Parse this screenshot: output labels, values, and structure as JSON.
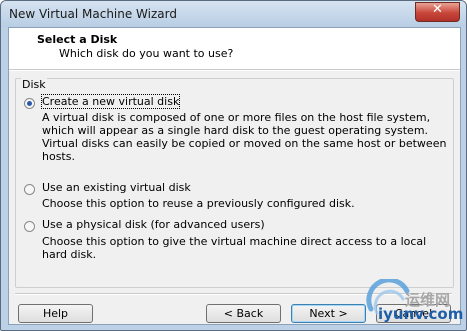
{
  "window": {
    "title": "New Virtual Machine Wizard"
  },
  "header": {
    "title": "Select a Disk",
    "subtitle": "Which disk do you want to use?"
  },
  "disk_group": {
    "legend": "Disk",
    "options": [
      {
        "label": "Create a new virtual disk",
        "selected": true,
        "description": "A virtual disk is composed of one or more files on the host file system, which will appear as a single hard disk to the guest operating system. Virtual disks can easily be copied or moved on the same host or between hosts."
      },
      {
        "label": "Use an existing virtual disk",
        "selected": false,
        "description": "Choose this option to reuse a previously configured disk."
      },
      {
        "label": "Use a physical disk (for advanced users)",
        "selected": false,
        "description": "Choose this option to give the virtual machine direct access to a local hard disk."
      }
    ]
  },
  "buttons": {
    "help": "Help",
    "back": "< Back",
    "next": "Next >",
    "cancel": "Cancel"
  },
  "watermark": {
    "text_cn": "运维网",
    "url": "iyunv.com"
  },
  "icons": {
    "close": "close-icon",
    "watermark_logo": "watermark-logo-icon"
  },
  "colors": {
    "title_bar": "#c3d5ea",
    "close_button": "#c8473a",
    "watermark_url": "#1e5ea8"
  }
}
